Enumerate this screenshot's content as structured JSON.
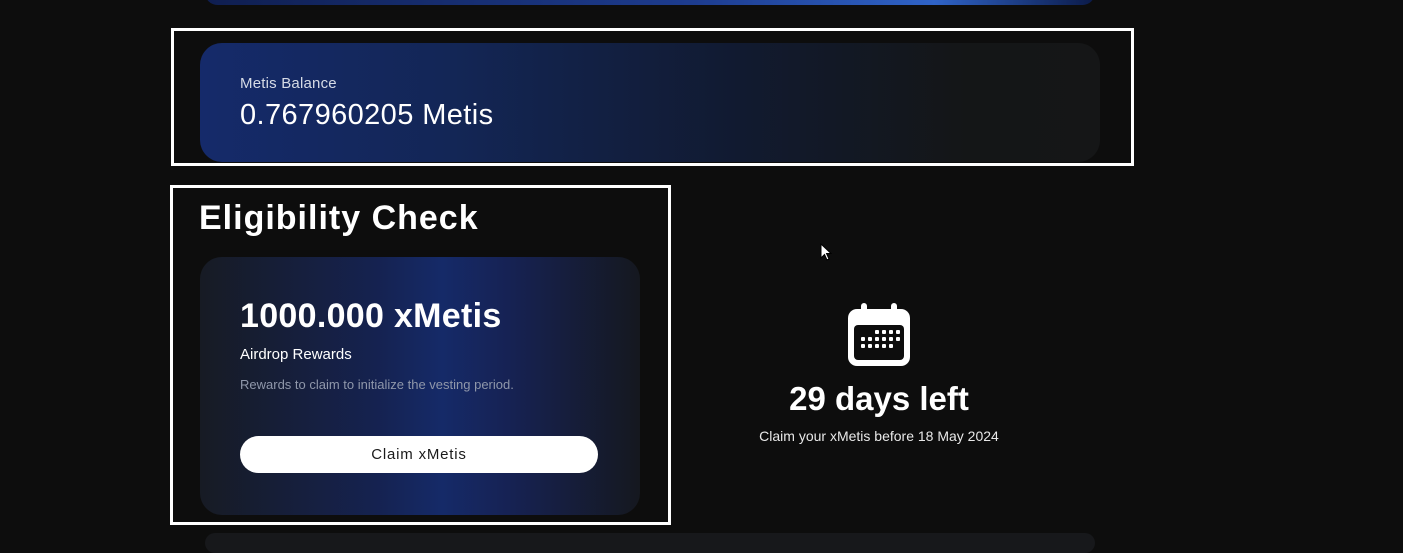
{
  "balance": {
    "label": "Metis Balance",
    "value": "0.767960205 Metis"
  },
  "eligibility": {
    "title": "Eligibility Check",
    "amount": "1000.000 xMetis",
    "reward_label": "Airdrop Rewards",
    "description": "Rewards to claim to initialize the vesting period.",
    "claim_button_label": "Claim xMetis"
  },
  "countdown": {
    "icon": "calendar-icon",
    "title": "29 days left",
    "subtitle": "Claim your xMetis before 18 May 2024"
  },
  "colors": {
    "background": "#0d0d0d",
    "accent_blue": "#1d3c8f",
    "highlight_frame": "#ffffff",
    "button_bg": "#ffffff"
  }
}
